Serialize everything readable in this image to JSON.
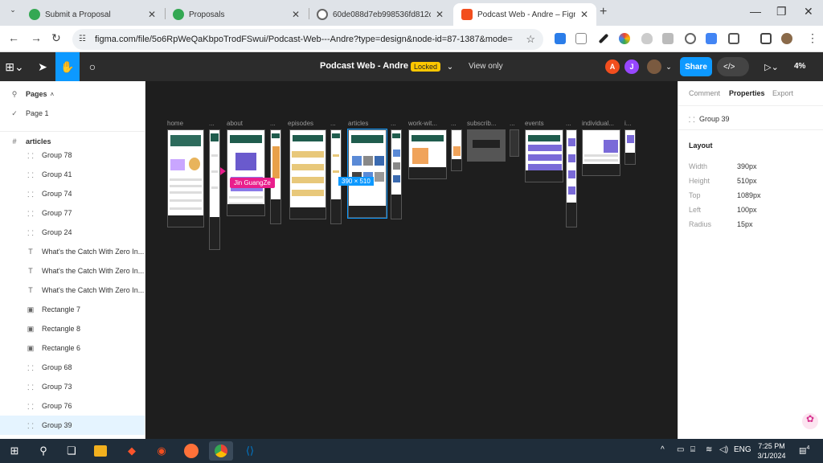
{
  "browser": {
    "tabs": [
      {
        "label": "Submit a Proposal",
        "favicon_color": "#34a853"
      },
      {
        "label": "Proposals",
        "favicon_color": "#34a853"
      },
      {
        "label": "60de088d7eb998536fd812c36b",
        "favicon_color": "#666666"
      },
      {
        "label": "Podcast Web - Andre – Figma",
        "favicon_color": "#f24e1e"
      }
    ],
    "url": "figma.com/file/5o6RpWeQaKbpoTrodFSwui/Podcast-Web---Andre?type=design&node-id=87-1387&mode=desi..."
  },
  "figma": {
    "file_title": "Podcast Web - Andre",
    "status_badge": "Locked",
    "view_mode": "View only",
    "avatars": [
      {
        "initial": "A",
        "color": "#f24e1e"
      },
      {
        "initial": "J",
        "color": "#9747ff"
      }
    ],
    "share_label": "Share",
    "code_label": "</>",
    "zoom": "4%",
    "pages_header": "Pages",
    "current_page": "Page 1",
    "layers_root": "articles",
    "layers": [
      {
        "name": "Group 78",
        "icon": "group"
      },
      {
        "name": "Group 41",
        "icon": "group"
      },
      {
        "name": "Group 74",
        "icon": "group"
      },
      {
        "name": "Group 77",
        "icon": "group"
      },
      {
        "name": "Group 24",
        "icon": "group"
      },
      {
        "name": "What's the Catch With Zero In...",
        "icon": "text"
      },
      {
        "name": "What's the Catch With Zero In...",
        "icon": "text"
      },
      {
        "name": "What's the Catch With Zero In...",
        "icon": "text"
      },
      {
        "name": "Rectangle 7",
        "icon": "image"
      },
      {
        "name": "Rectangle 8",
        "icon": "image"
      },
      {
        "name": "Rectangle 6",
        "icon": "image"
      },
      {
        "name": "Group 68",
        "icon": "group"
      },
      {
        "name": "Group 73",
        "icon": "group"
      },
      {
        "name": "Group 76",
        "icon": "group"
      },
      {
        "name": "Group 39",
        "icon": "group",
        "selected": true
      }
    ],
    "canvas": {
      "frame_labels": [
        "home",
        "...",
        "about",
        "...",
        "episodes",
        "...",
        "articles",
        "...",
        "work-wit...",
        "...",
        "subscrib...",
        "...",
        "events",
        "...",
        "individual...",
        "i..."
      ],
      "selection_size": "390 × 510",
      "cursor_user": "Jin GuangZe"
    },
    "properties": {
      "tabs": [
        "Comment",
        "Properties",
        "Export"
      ],
      "active_tab": "Properties",
      "selected_name": "Group 39",
      "section": "Layout",
      "fields": [
        {
          "label": "Width",
          "value": "390px"
        },
        {
          "label": "Height",
          "value": "510px"
        },
        {
          "label": "Top",
          "value": "1089px"
        },
        {
          "label": "Left",
          "value": "100px"
        },
        {
          "label": "Radius",
          "value": "15px"
        }
      ]
    }
  },
  "taskbar": {
    "time": "7:25 PM",
    "date": "3/1/2024",
    "lang": "ENG",
    "notification_count": "4"
  }
}
